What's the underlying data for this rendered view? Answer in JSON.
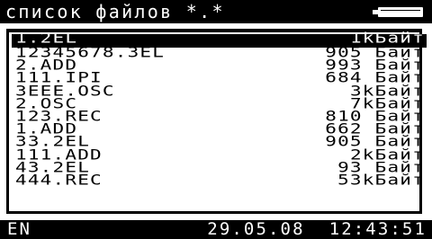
{
  "header": {
    "title": "список файлов *.*",
    "battery_icon": "battery-icon"
  },
  "files": [
    {
      "name": "1.2EL",
      "size": "1kБайт",
      "selected": true
    },
    {
      "name": "12345678.3EL",
      "size": "905 Байт"
    },
    {
      "name": "2.ADD",
      "size": "993 Байт"
    },
    {
      "name": "111.IPI",
      "size": "684 Байт"
    },
    {
      "name": "3EEE.OSC",
      "size": "3kБайт"
    },
    {
      "name": "2.OSC",
      "size": "7kБайт"
    },
    {
      "name": "123.REC",
      "size": "810 Байт"
    },
    {
      "name": "1.ADD",
      "size": "662 Байт"
    },
    {
      "name": "33.2EL",
      "size": "905 Байт"
    },
    {
      "name": "111.ADD",
      "size": "2kБайт"
    },
    {
      "name": "43.2EL",
      "size": "93 Байт"
    },
    {
      "name": "444.REC",
      "size": "53kБайт"
    }
  ],
  "status": {
    "language": "EN",
    "date": "29.05.08",
    "time": "12:43:51"
  },
  "colors": {
    "background": "#ffffff",
    "foreground": "#000000"
  }
}
